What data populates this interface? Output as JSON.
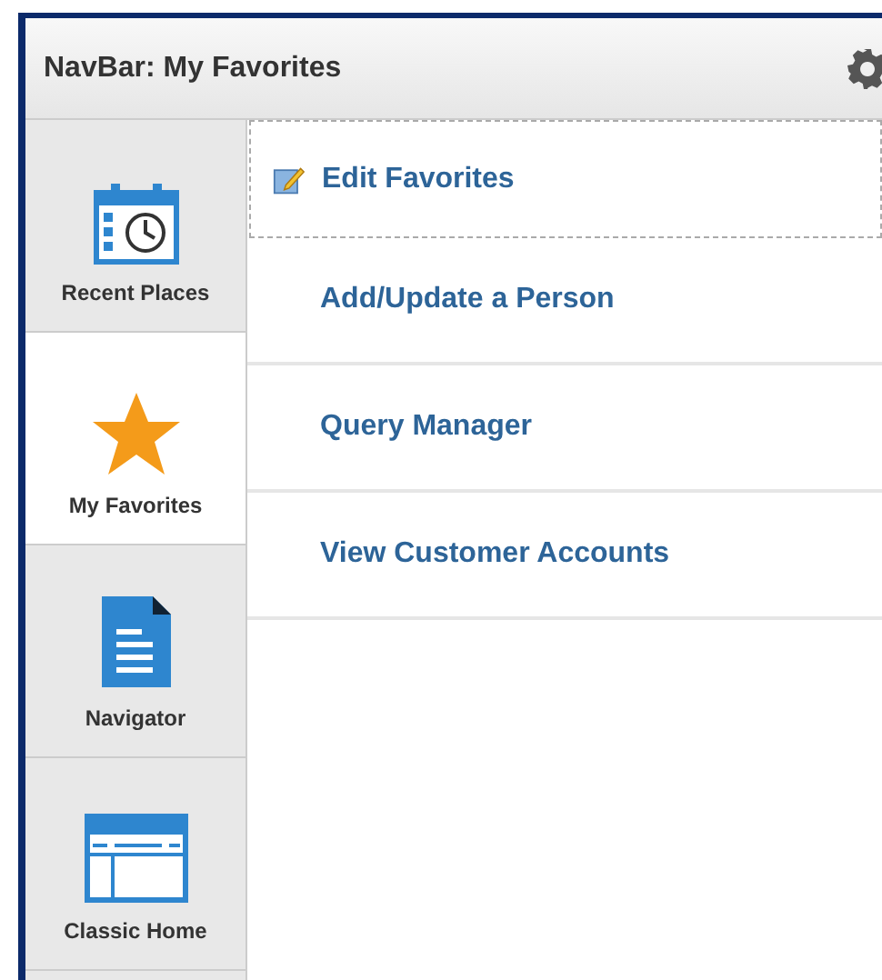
{
  "header": {
    "title": "NavBar: My Favorites"
  },
  "sidebar": {
    "items": [
      {
        "label": "Recent Places",
        "kind": "calendar",
        "selected": false
      },
      {
        "label": "My Favorites",
        "kind": "star",
        "selected": true
      },
      {
        "label": "Navigator",
        "kind": "document",
        "selected": false
      },
      {
        "label": "Classic Home",
        "kind": "window",
        "selected": false
      }
    ]
  },
  "content": {
    "edit_link": "Edit Favorites",
    "favorites": [
      "Add/Update a Person",
      "Query Manager",
      "View Customer Accounts"
    ]
  }
}
